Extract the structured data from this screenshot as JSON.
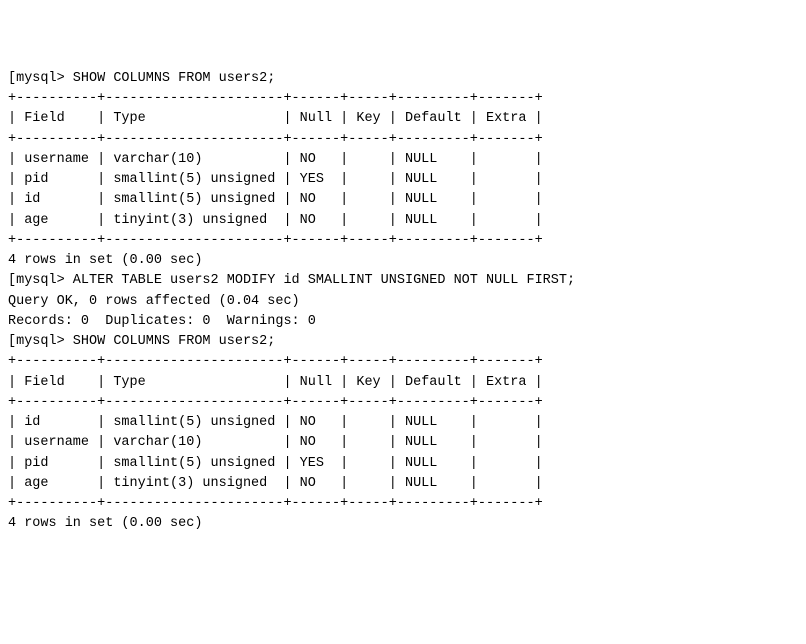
{
  "chart_data": {
    "type": "table",
    "queries": [
      {
        "prompt": "mysql>",
        "sql": "SHOW COLUMNS FROM users2;",
        "columns": [
          "Field",
          "Type",
          "Null",
          "Key",
          "Default",
          "Extra"
        ],
        "rows": [
          {
            "Field": "username",
            "Type": "varchar(10)",
            "Null": "NO",
            "Key": "",
            "Default": "NULL",
            "Extra": ""
          },
          {
            "Field": "pid",
            "Type": "smallint(5) unsigned",
            "Null": "YES",
            "Key": "",
            "Default": "NULL",
            "Extra": ""
          },
          {
            "Field": "id",
            "Type": "smallint(5) unsigned",
            "Null": "NO",
            "Key": "",
            "Default": "NULL",
            "Extra": ""
          },
          {
            "Field": "age",
            "Type": "tinyint(3) unsigned",
            "Null": "NO",
            "Key": "",
            "Default": "NULL",
            "Extra": ""
          }
        ],
        "footer": "4 rows in set (0.00 sec)"
      },
      {
        "prompt": "mysql>",
        "sql": "ALTER TABLE users2 MODIFY id SMALLINT UNSIGNED NOT NULL FIRST;",
        "result_lines": [
          "Query OK, 0 rows affected (0.04 sec)",
          "Records: 0  Duplicates: 0  Warnings: 0"
        ]
      },
      {
        "prompt": "mysql>",
        "sql": "SHOW COLUMNS FROM users2;",
        "columns": [
          "Field",
          "Type",
          "Null",
          "Key",
          "Default",
          "Extra"
        ],
        "rows": [
          {
            "Field": "id",
            "Type": "smallint(5) unsigned",
            "Null": "NO",
            "Key": "",
            "Default": "NULL",
            "Extra": ""
          },
          {
            "Field": "username",
            "Type": "varchar(10)",
            "Null": "NO",
            "Key": "",
            "Default": "NULL",
            "Extra": ""
          },
          {
            "Field": "pid",
            "Type": "smallint(5) unsigned",
            "Null": "YES",
            "Key": "",
            "Default": "NULL",
            "Extra": ""
          },
          {
            "Field": "age",
            "Type": "tinyint(3) unsigned",
            "Null": "NO",
            "Key": "",
            "Default": "NULL",
            "Extra": ""
          }
        ],
        "footer": "4 rows in set (0.00 sec)"
      }
    ]
  },
  "col_widths": {
    "Field": 8,
    "Type": 20,
    "Null": 4,
    "Key": 3,
    "Default": 7,
    "Extra": 5
  },
  "prompt_open": "[",
  "prompt": "mysql>",
  "sql1": "SHOW COLUMNS FROM users2;",
  "sql2": "ALTER TABLE users2 MODIFY id SMALLINT UNSIGNED NOT NULL FIRST;",
  "sql3": "SHOW COLUMNS FROM users2;",
  "alter_line1": "Query OK, 0 rows affected (0.04 sec)",
  "alter_line2": "Records: 0  Duplicates: 0  Warnings: 0",
  "footer1": "4 rows in set (0.00 sec)",
  "footer2": "4 rows in set (0.00 sec)"
}
